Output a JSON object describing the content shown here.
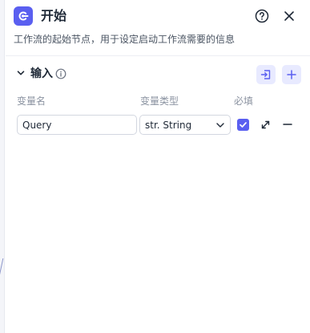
{
  "header": {
    "title": "开始",
    "description": "工作流的起始节点，用于设定启动工作流需要的信息",
    "icons": {
      "node": "start-node-icon",
      "help": "help-circle-icon",
      "close": "close-icon"
    }
  },
  "input_section": {
    "title": "输入",
    "icons": {
      "toggle": "chevron-down-icon",
      "info": "info-icon",
      "import": "import-icon",
      "add": "plus-icon"
    },
    "columns": {
      "name": "变量名",
      "type": "变量类型",
      "required": "必填"
    },
    "rows": [
      {
        "name": "Query",
        "type": "str. String",
        "required": true
      }
    ]
  },
  "colors": {
    "accent": "#5a5ff0",
    "accent_soft": "#e8eaff",
    "text_primary": "#1f2937",
    "text_muted": "#8b93a1"
  }
}
